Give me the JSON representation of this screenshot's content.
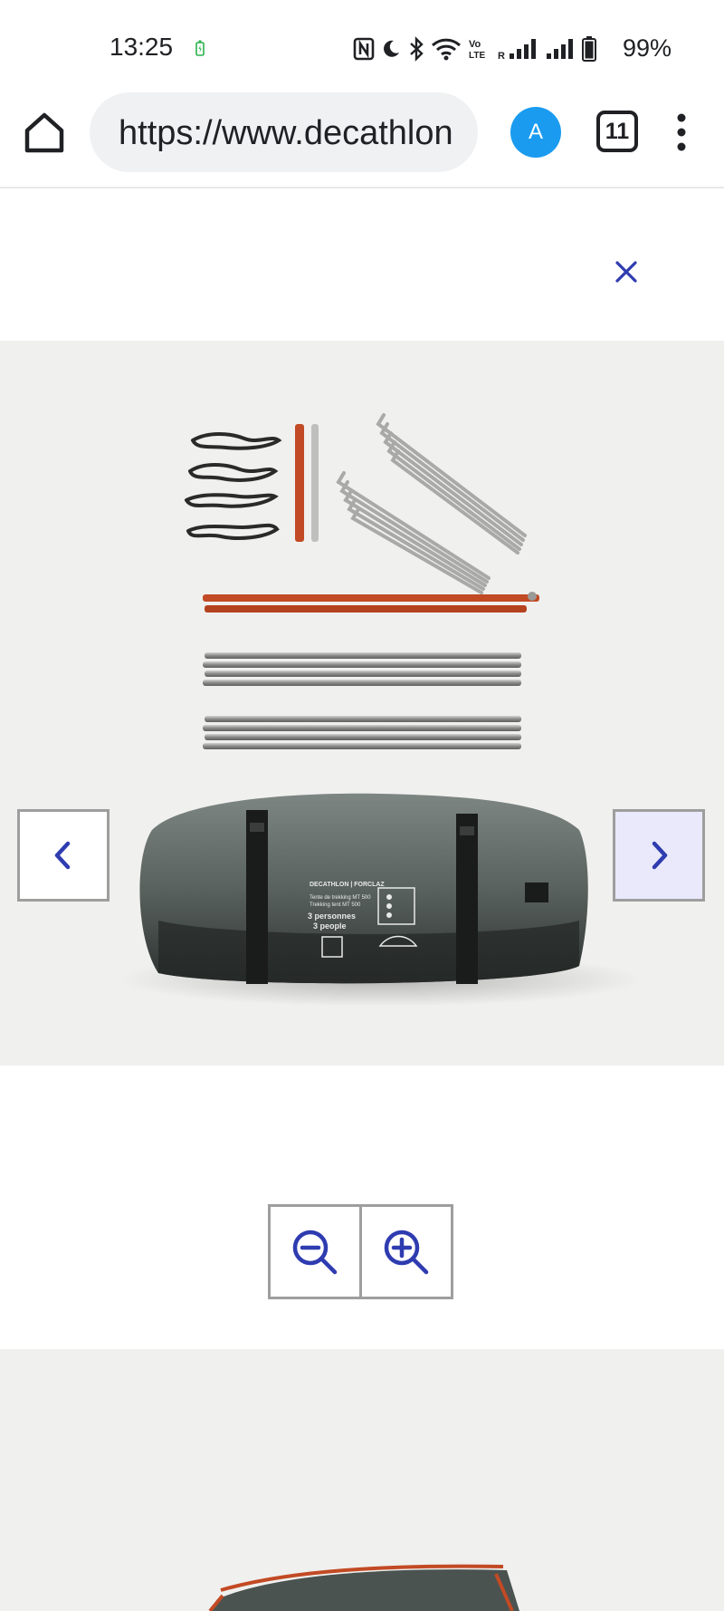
{
  "status_bar": {
    "time": "13:25",
    "battery_percent": "99%",
    "icons": [
      "charging-icon",
      "nfc-icon",
      "do-not-disturb-moon-icon",
      "bluetooth-icon",
      "wifi-icon",
      "volte-icon",
      "signal-r-icon",
      "signal-icon",
      "battery-icon"
    ],
    "volte_label": "Vo\nLTE",
    "roaming_label": "R"
  },
  "browser": {
    "url": "https://www.decathlon",
    "account_initial": "A",
    "tab_count": "11",
    "icons": [
      "home-icon",
      "account-avatar",
      "tab-switcher-icon",
      "more-menu-icon"
    ]
  },
  "product_viewer": {
    "close_icon": "close-icon",
    "prev_icon": "chevron-left-icon",
    "next_icon": "chevron-right-icon",
    "zoom_out_icon": "zoom-out-icon",
    "zoom_in_icon": "zoom-in-icon",
    "image": {
      "bag_brand": "DECATHLON | FORCLAZ",
      "bag_line1": "Tente de trekking MT 500",
      "bag_line2": "Trekking tent MT 500",
      "bag_text1": "3 personnes",
      "bag_text2": "3 people"
    }
  },
  "colors": {
    "accent": "#2f3cb0",
    "avatar_bg": "#1a9bf0",
    "gallery_bg": "#f0f0ee",
    "next_btn_bg": "#e9e9fb"
  }
}
